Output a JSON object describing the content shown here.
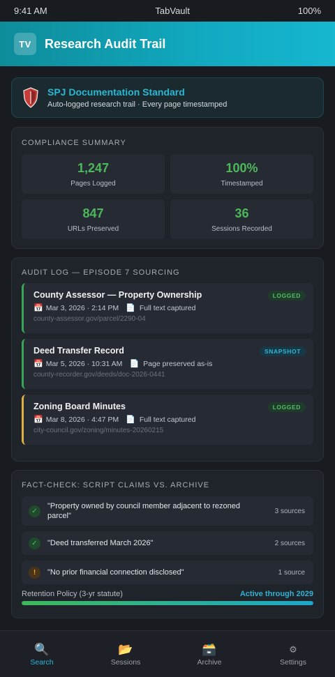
{
  "status_bar": {
    "time": "9:41 AM",
    "app_name": "TabVault",
    "battery": "100%"
  },
  "header": {
    "logo_text": "TV",
    "title": "Research Audit Trail"
  },
  "banner": {
    "title": "SPJ Documentation Standard",
    "subtitle": "Auto-logged research trail · Every page timestamped"
  },
  "summary": {
    "title": "COMPLIANCE SUMMARY",
    "stats": [
      {
        "value": "1,247",
        "label": "Pages Logged"
      },
      {
        "value": "100%",
        "label": "Timestamped"
      },
      {
        "value": "847",
        "label": "URLs Preserved"
      },
      {
        "value": "36",
        "label": "Sessions Recorded"
      }
    ]
  },
  "audit": {
    "title": "AUDIT LOG — EPISODE 7 SOURCING",
    "items": [
      {
        "title": "County Assessor — Property Ownership",
        "badge": "LOGGED",
        "timestamp": "Mar 3, 2026 · 2:14 PM",
        "capture": "Full text captured",
        "url": "county-assessor.gov/parcel/2290-04"
      },
      {
        "title": "Deed Transfer Record",
        "badge": "SNAPSHOT",
        "timestamp": "Mar 5, 2026 · 10:31 AM",
        "capture": "Page preserved as-is",
        "url": "county-recorder.gov/deeds/doc-2026-0441"
      },
      {
        "title": "Zoning Board Minutes",
        "badge": "LOGGED",
        "timestamp": "Mar 8, 2026 · 4:47 PM",
        "capture": "Full text captured",
        "url": "city-council.gov/zoning/minutes-20260215"
      }
    ]
  },
  "factcheck": {
    "title": "FACT-CHECK: SCRIPT CLAIMS VS. ARCHIVE",
    "claims": [
      {
        "icon": "✓",
        "text": "\"Property owned by council member adjacent to rezoned parcel\"",
        "sources": "3 sources"
      },
      {
        "icon": "✓",
        "text": "\"Deed transferred March 2026\"",
        "sources": "2 sources"
      },
      {
        "icon": "!",
        "text": "\"No prior financial connection disclosed\"",
        "sources": "1 source"
      }
    ],
    "retention_label": "Retention Policy (3-yr statute)",
    "retention_status": "Active through 2029",
    "retention_progress": 1.0
  },
  "nav": [
    {
      "label": "Search",
      "icon": "🔍"
    },
    {
      "label": "Sessions",
      "icon": "📂"
    },
    {
      "label": "Archive",
      "icon": "🗃️"
    },
    {
      "label": "Settings",
      "icon": "⚙"
    }
  ],
  "colors": {
    "accent": "#2fb4d6",
    "success": "#4cb85a",
    "warning": "#e0b045",
    "header_gradient_start": "#0e8c9a",
    "header_gradient_end": "#16b7cf"
  }
}
